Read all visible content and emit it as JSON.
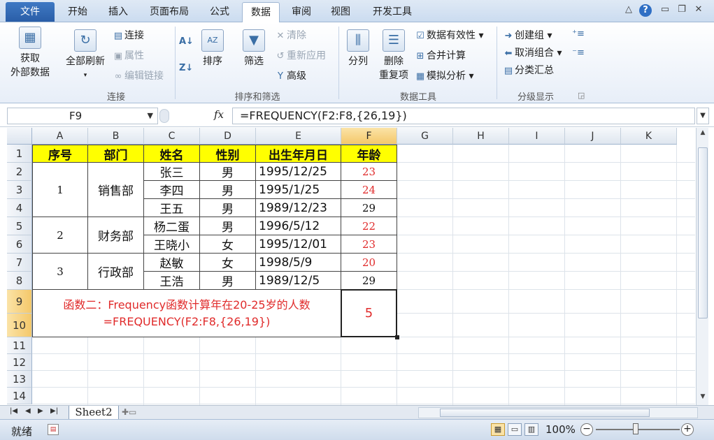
{
  "tabs": {
    "file": "文件",
    "items": [
      "开始",
      "插入",
      "页面布局",
      "公式",
      "数据",
      "审阅",
      "视图",
      "开发工具"
    ],
    "active": "数据"
  },
  "ribbon": {
    "get_external": "获取\n外部数据",
    "get_external_l1": "获取",
    "get_external_l2": "外部数据",
    "refresh_all": "全部刷新",
    "connections": "连接",
    "properties": "属性",
    "edit_links": "编辑链接",
    "group_connect": "连接",
    "sort": "排序",
    "filter": "筛选",
    "clear": "清除",
    "reapply": "重新应用",
    "advanced": "高级",
    "group_sort": "排序和筛选",
    "text_to_columns": "分列",
    "remove_dup_l1": "删除",
    "remove_dup_l2": "重复项",
    "data_validation": "数据有效性",
    "consolidate": "合并计算",
    "whatif": "模拟分析",
    "group_tools": "数据工具",
    "group_btn": "创建组",
    "ungroup_btn": "取消组合",
    "subtotal": "分类汇总",
    "group_outline": "分级显示"
  },
  "formula_bar": {
    "name_box": "F9",
    "formula": "=FREQUENCY(F2:F8,{26,19})",
    "fx": "fx"
  },
  "columns": [
    "A",
    "B",
    "C",
    "D",
    "E",
    "F",
    "G",
    "H",
    "I",
    "J",
    "K"
  ],
  "rows": [
    "1",
    "2",
    "3",
    "4",
    "5",
    "6",
    "7",
    "8",
    "9",
    "10",
    "11",
    "12",
    "13",
    "14"
  ],
  "table": {
    "headers": [
      "序号",
      "部门",
      "姓名",
      "性别",
      "出生年月日",
      "年龄"
    ],
    "groups": [
      {
        "no": "1",
        "dept": "销售部"
      },
      {
        "no": "2",
        "dept": "财务部"
      },
      {
        "no": "3",
        "dept": "行政部"
      }
    ],
    "people": [
      {
        "name": "张三",
        "sex": "男",
        "dob": "1995/12/25",
        "age": "23"
      },
      {
        "name": "李四",
        "sex": "男",
        "dob": "1995/1/25",
        "age": "24"
      },
      {
        "name": "王五",
        "sex": "男",
        "dob": "1989/12/23",
        "age": "29"
      },
      {
        "name": "杨二蛋",
        "sex": "男",
        "dob": "1996/5/12",
        "age": "22"
      },
      {
        "name": "王晓小",
        "sex": "女",
        "dob": "1995/12/01",
        "age": "23"
      },
      {
        "name": "赵敏",
        "sex": "女",
        "dob": "1998/5/9",
        "age": "20"
      },
      {
        "name": "王浩",
        "sex": "男",
        "dob": "1989/12/5",
        "age": "29"
      }
    ],
    "note_line1": "函数二：Frequency函数计算年在20-25岁的人数",
    "note_line2": "=FREQUENCY(F2:F8,{26,19})",
    "result": "5"
  },
  "sheet_tab": "Sheet2",
  "status": {
    "ready": "就绪",
    "zoom": "100%"
  },
  "colors": {
    "header_fill": "#ffff00",
    "red_text": "#e02b2b",
    "selection": "#f4c86a"
  }
}
